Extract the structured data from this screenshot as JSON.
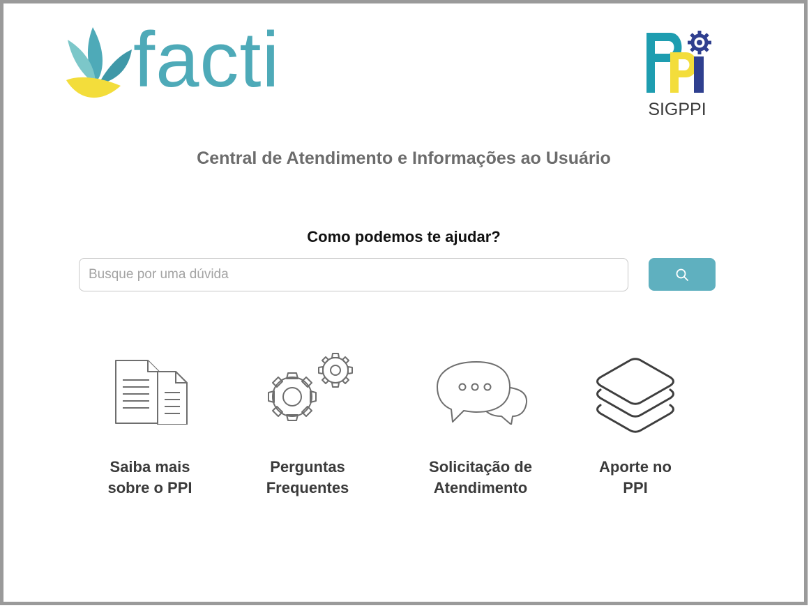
{
  "brand": {
    "logo_text": "facti",
    "secondary_logo_text": "SIGPPI",
    "colors": {
      "teal": "#4eaab8",
      "yellow": "#f3dd3b",
      "navy": "#2f3f8f",
      "button": "#5fb0bf"
    }
  },
  "header": {
    "title": "Central de Atendimento e Informações ao Usuário"
  },
  "help": {
    "heading": "Como podemos te ajudar?",
    "search": {
      "placeholder": "Busque por uma dúvida",
      "value": "",
      "button_icon": "search-icon"
    }
  },
  "cards": [
    {
      "label": "Saiba mais\nsobre o PPI",
      "icon": "documents-icon"
    },
    {
      "label": "Perguntas\nFrequentes",
      "icon": "gears-icon"
    },
    {
      "label": "Solicitação de\nAtendimento",
      "icon": "chat-bubbles-icon"
    },
    {
      "label": "Aporte no\nPPI",
      "icon": "layers-icon"
    }
  ]
}
